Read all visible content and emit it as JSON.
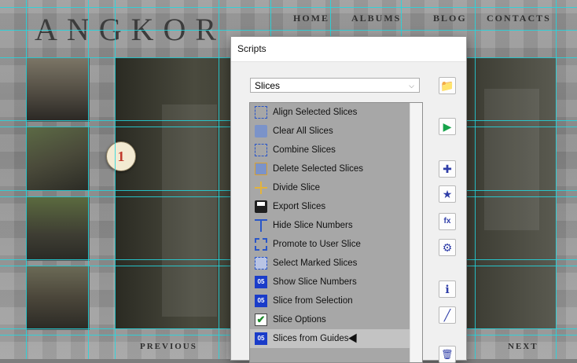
{
  "website": {
    "logo": "ANGKOR",
    "nav": [
      "HOME",
      "ALBUMS",
      "BLOG",
      "CONTACTS"
    ],
    "marker": "1",
    "pager": {
      "previous": "PREVIOUS",
      "next": "NEXT"
    }
  },
  "dialog": {
    "title": "Scripts",
    "category_select": "Slices",
    "items": [
      {
        "label": "Align Selected Slices",
        "icon": "align-slices-icon"
      },
      {
        "label": "Clear All Slices",
        "icon": "trash-icon"
      },
      {
        "label": "Combine Slices",
        "icon": "combine-slices-icon"
      },
      {
        "label": "Delete Selected Slices",
        "icon": "delete-slices-icon"
      },
      {
        "label": "Divide Slice",
        "icon": "divide-slice-icon"
      },
      {
        "label": "Export Slices",
        "icon": "floppy-disk-icon"
      },
      {
        "label": "Hide Slice Numbers",
        "icon": "hide-numbers-icon"
      },
      {
        "label": "Promote to User Slice",
        "icon": "promote-slice-icon"
      },
      {
        "label": "Select Marked Slices",
        "icon": "select-slices-icon"
      },
      {
        "label": "Show Slice Numbers",
        "icon": "slice-number-icon",
        "badge": "05"
      },
      {
        "label": "Slice from Selection",
        "icon": "slice-number-icon",
        "badge": "05"
      },
      {
        "label": "Slice Options",
        "icon": "checkbox-icon",
        "badge": "✔"
      },
      {
        "label": "Slices from Guides",
        "icon": "slice-number-icon",
        "badge": "05"
      }
    ],
    "selected_index": 12,
    "toolbar": {
      "folder": "📁",
      "run": "▶",
      "add": "✚",
      "favorite": "★",
      "fx": "fx",
      "settings": "⚙",
      "info": "ℹ",
      "edit": "╱",
      "delete": "🗑"
    }
  },
  "colors": {
    "guide": "#22d8e0",
    "accent": "#2f3ea8",
    "run": "#16a34a"
  }
}
